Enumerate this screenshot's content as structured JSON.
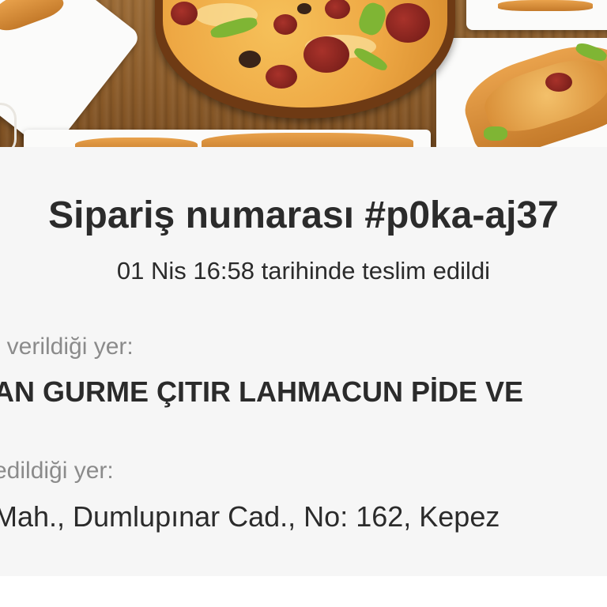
{
  "hero": {
    "image_icon": "food-photo-pizza-pide"
  },
  "order": {
    "title": "Sipariş numarası #p0ka-aj37",
    "delivered_text": "01 Nis 16:58 tarihinde teslim edildi"
  },
  "restaurant": {
    "label": "ı verildiği yer:",
    "name": "AN GURME ÇITIR LAHMACUN PİDE VE"
  },
  "delivery": {
    "label": "edildiği yer:",
    "address": "Mah., Dumlupınar Cad., No: 162, Kepez"
  },
  "colors": {
    "background": "#f6f6f6",
    "text": "#2b2b2b",
    "label": "#8b8b8b"
  }
}
